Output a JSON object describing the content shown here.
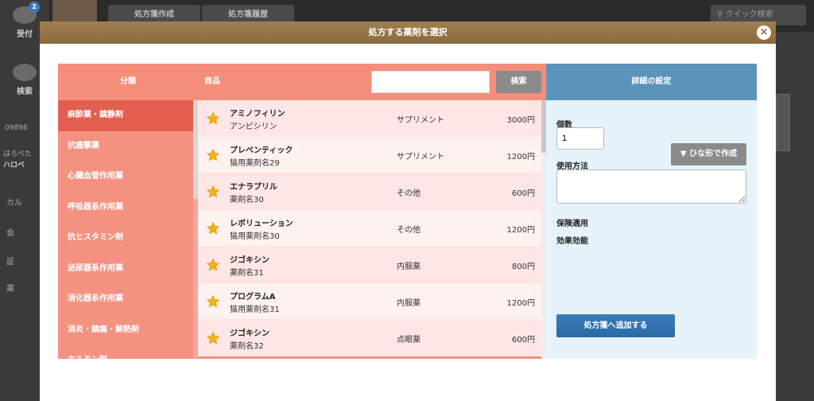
{
  "background": {
    "sidebar": [
      {
        "label": "受付",
        "badge": "2"
      },
      {
        "label": "検索"
      }
    ],
    "sidebar_texts": [
      "09898",
      "はろべた",
      "ハロベ",
      "カル",
      "会",
      "証",
      "薬"
    ],
    "tabs": [
      "処方箋作成",
      "処方箋履歴"
    ],
    "search_placeholder": "クイック検索"
  },
  "modal": {
    "title": "処方する薬剤を選択",
    "close_icon": "×",
    "list": {
      "category_header": "分類",
      "product_header": "商品",
      "search_value": "",
      "search_button": "検索",
      "categories": [
        "麻酔薬・鎮静剤",
        "抗癌撃薬",
        "心臓血管作用薬",
        "呼吸器系作用薬",
        "抗ヒスタミン剤",
        "泌尿器系作用薬",
        "消化器系作用薬",
        "消炎・鎮痛・解熱剤",
        "ホルモン剤"
      ],
      "products": [
        {
          "name": "アミノフィリン",
          "sub": "アンピシリン",
          "type": "サプリメント",
          "price": "3000円"
        },
        {
          "name": "プレベンティック",
          "sub": "猫用薬剤名29",
          "type": "サプリメント",
          "price": "1200円"
        },
        {
          "name": "エナラプリル",
          "sub": "薬剤名30",
          "type": "その他",
          "price": "600円"
        },
        {
          "name": "レボリューション",
          "sub": "猫用薬剤名30",
          "type": "その他",
          "price": "1200円"
        },
        {
          "name": "ジゴキシン",
          "sub": "薬剤名31",
          "type": "内服薬",
          "price": "800円"
        },
        {
          "name": "プログラムA",
          "sub": "猫用薬剤名31",
          "type": "内服薬",
          "price": "1200円"
        },
        {
          "name": "ジゴキシン",
          "sub": "薬剤名32",
          "type": "点眼薬",
          "price": "600円"
        }
      ]
    },
    "detail": {
      "header": "詳細の設定",
      "quantity_label": "個数",
      "quantity_value": "1",
      "template_button": "▼ ひな形で作成",
      "usage_label": "使用方法",
      "insurance_label": "保険適用",
      "efficacy_label": "効果効能",
      "add_button": "処方箋へ追加する"
    }
  },
  "colors": {
    "modal_header": "#8a6a3f",
    "list_bg": "#f39080",
    "active_category": "#e25f4f",
    "detail_header": "#5c93bb",
    "detail_bg": "#e6f3fb",
    "add_button": "#2b6aa4",
    "star": "#f2b21a"
  }
}
